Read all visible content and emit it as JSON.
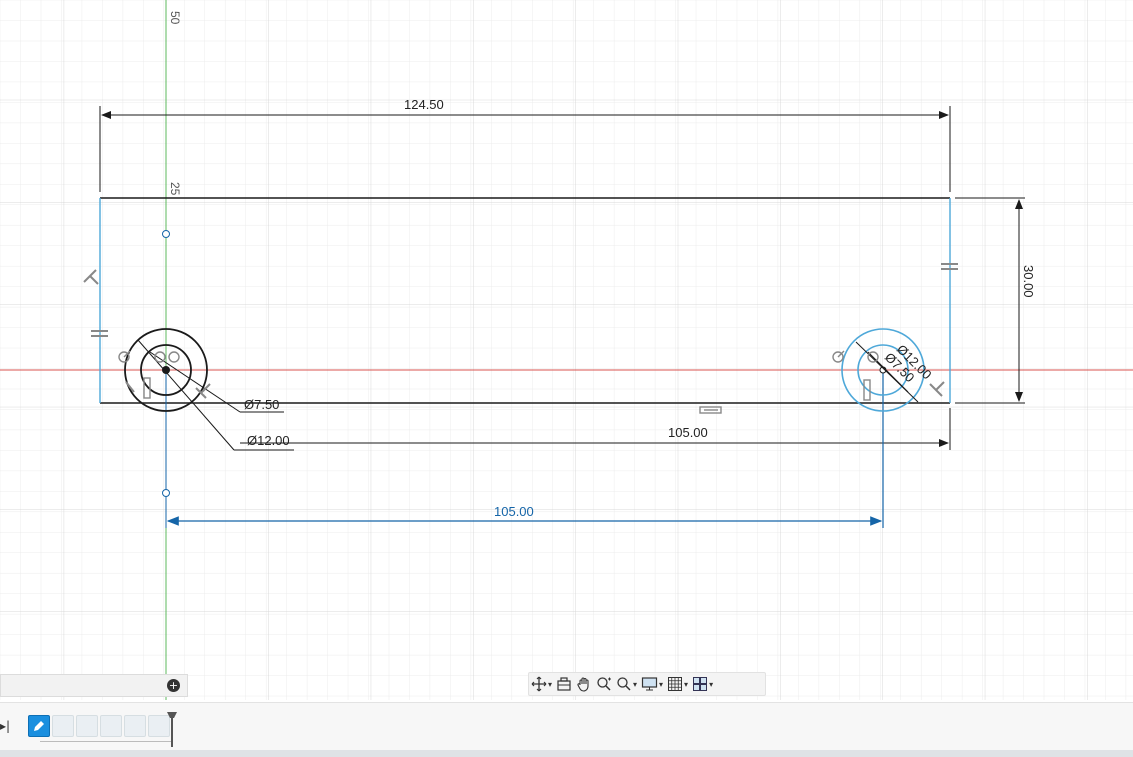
{
  "axis_labels": {
    "y_top": "50",
    "y_mid": "25"
  },
  "dimensions": {
    "overall_width": "124.50",
    "height": "30.00",
    "hole_spacing_bottom": "105.00",
    "hole_spacing_driven": "105.00",
    "small_diameter": "Ø7.50",
    "large_diameter": "Ø12.00",
    "right_small_diameter": "Ø7.50",
    "right_large_diameter": "Ø12.00"
  },
  "colors": {
    "sketch_line": "#1a1a1a",
    "construction_blue": "#4ea8d9",
    "driven_dim_blue": "#1565a8",
    "x_axis": "#d9534f",
    "y_axis": "#5cb85c",
    "grid": "#e4e4e4"
  },
  "navbar": {
    "items": [
      "orbit-icon",
      "look-at-icon",
      "pan-icon",
      "zoom-icon",
      "zoom-window-icon",
      "display-settings-icon",
      "grid-settings-icon",
      "viewports-icon"
    ]
  },
  "comments": {
    "add_icon": "+"
  },
  "timeline": {
    "play_to_end_icon": "▸|",
    "features": [
      "sketch",
      "extrude",
      "sketch",
      "extrude",
      "sketch",
      "extrude"
    ]
  }
}
